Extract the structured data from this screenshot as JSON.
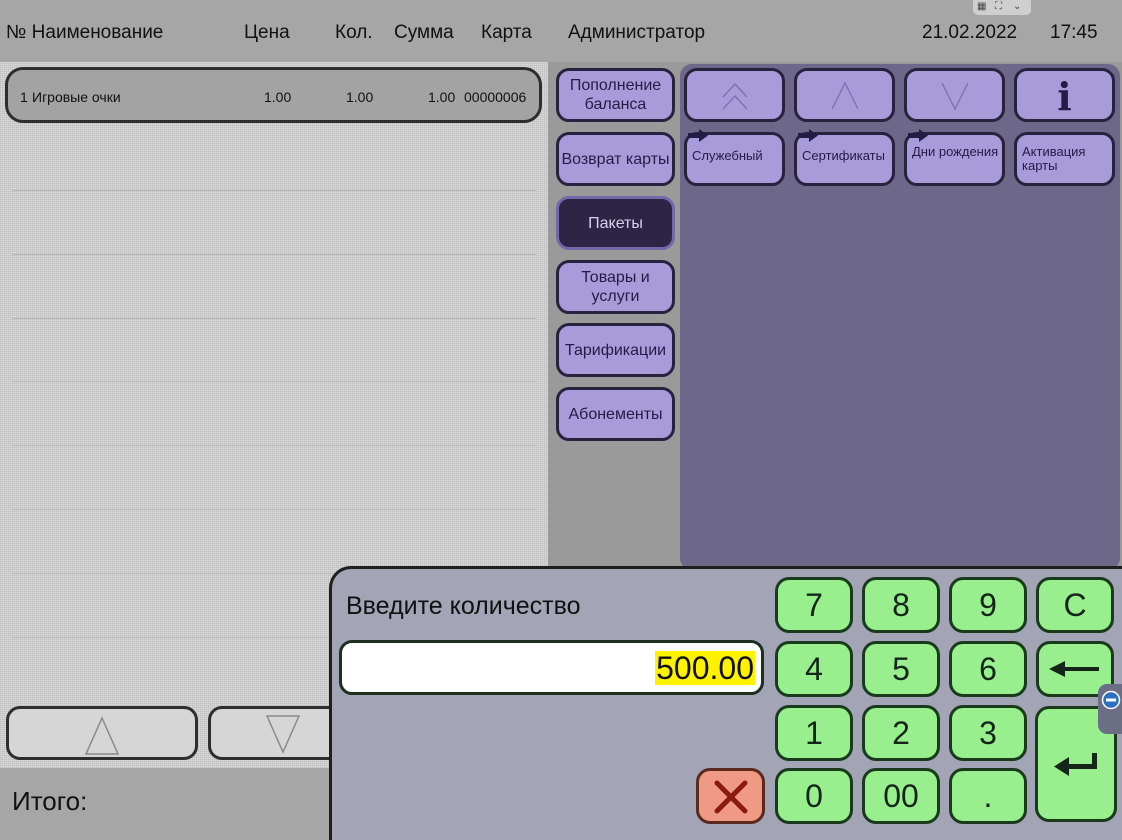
{
  "order": {
    "headers": {
      "name": "№ Наименование",
      "price": "Цена",
      "qty": "Кол.",
      "sum": "Сумма",
      "card": "Карта"
    },
    "rows": [
      {
        "num": "1",
        "name": "Игровые очки",
        "price": "1.00",
        "qty": "1.00",
        "sum": "1.00",
        "card": "00000006"
      }
    ],
    "total_label": "Итого:"
  },
  "header": {
    "user": "Администратор",
    "date": "21.02.2022",
    "time": "17:45"
  },
  "menu": {
    "items": [
      {
        "label": "Пополнение баланса",
        "active": false
      },
      {
        "label": "Возврат карты",
        "active": false
      },
      {
        "label": "Пакеты",
        "active": true
      },
      {
        "label": "Товары и услуги",
        "active": false
      },
      {
        "label": "Тарификации",
        "active": false
      },
      {
        "label": "Абонементы",
        "active": false
      }
    ]
  },
  "tiles": [
    {
      "label": "Служебный"
    },
    {
      "label": "Сертификаты"
    },
    {
      "label": "Дни рождения"
    },
    {
      "label": "Активация карты"
    }
  ],
  "dialog": {
    "title": "Введите количество",
    "value": "500.00",
    "keys": {
      "k7": "7",
      "k8": "8",
      "k9": "9",
      "clear": "C",
      "k4": "4",
      "k5": "5",
      "k6": "6",
      "k1": "1",
      "k2": "2",
      "k3": "3",
      "k0": "0",
      "k00": "00",
      "dot": "."
    }
  },
  "icons": {
    "scroll_up": "triangle-up-outline-icon",
    "scroll_down": "triangle-down-outline-icon",
    "info": "info-icon",
    "tile_arrow": "arrow-right-icon",
    "backspace": "arrow-left-icon",
    "enter": "enter-icon",
    "cancel": "close-icon",
    "remote": "remote-session-icon"
  },
  "colors": {
    "menu_button": "#a79bd9",
    "menu_button_active": "#2d2446",
    "content_area": "#6d6789",
    "key_green": "#99ef8e",
    "cancel_red": "#f09a86",
    "value_highlight": "#fff200"
  }
}
